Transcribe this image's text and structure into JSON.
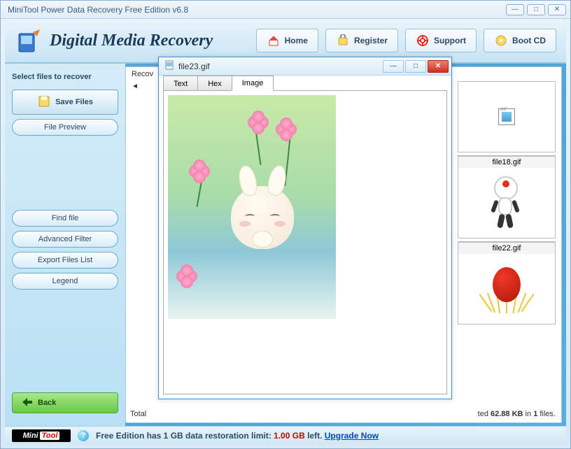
{
  "outer": {
    "title": "MiniTool Power Data Recovery Free Edition v6.8"
  },
  "header": {
    "app_name": "Digital Media Recovery",
    "buttons": {
      "home": "Home",
      "register": "Register",
      "support": "Support",
      "bootcd": "Boot CD"
    }
  },
  "sidebar": {
    "label": "Select files to recover",
    "save_files": "Save Files",
    "file_preview": "File Preview",
    "find_file": "Find file",
    "advanced_filter": "Advanced Filter",
    "export_files_list": "Export Files List",
    "legend": "Legend",
    "back": "Back"
  },
  "content": {
    "header": "Recov",
    "thumbs": [
      {
        "caption": "file18.gif"
      },
      {
        "caption": "file22.gif"
      }
    ],
    "status_prefix": "Total",
    "status_suffix_1": "ted ",
    "status_size": "62.88 KB",
    "status_suffix_2": " in ",
    "status_count": "1",
    "status_suffix_3": " files."
  },
  "preview": {
    "title": "file23.gif",
    "tabs": {
      "text": "Text",
      "hex": "Hex",
      "image": "Image"
    }
  },
  "footer": {
    "text_1": "Free Edition has 1 GB data restoration limit: ",
    "gb": "1.00 GB",
    "text_2": " left. ",
    "upgrade": "Upgrade Now"
  }
}
